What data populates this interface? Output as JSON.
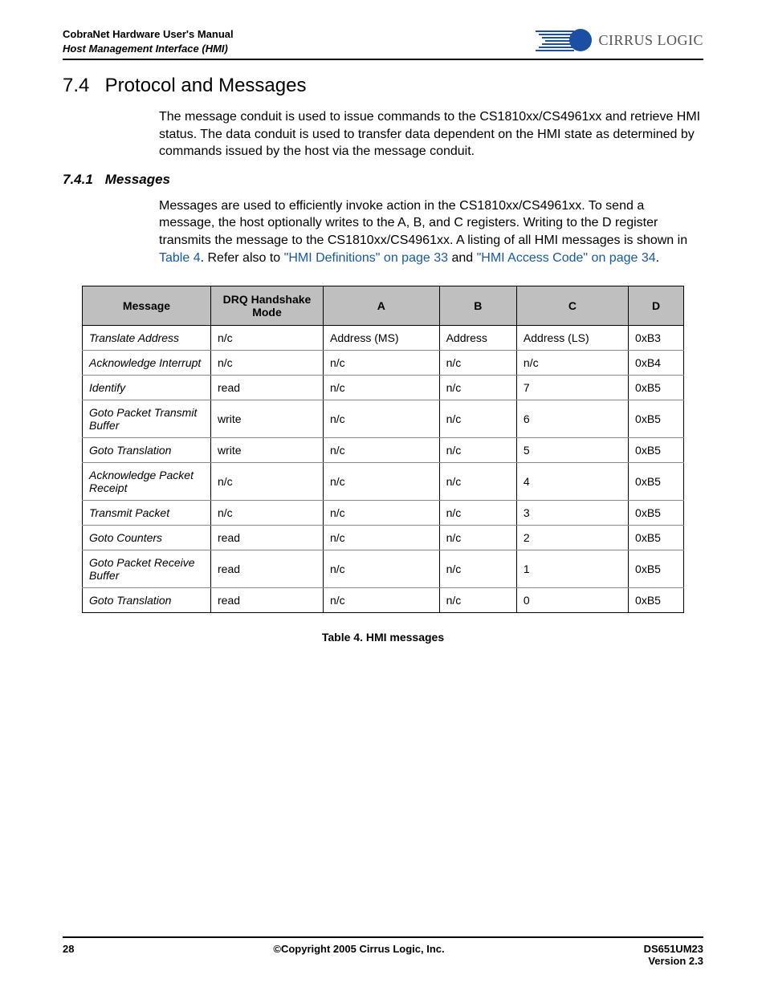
{
  "header": {
    "title_line1": "CobraNet Hardware User's Manual",
    "title_line2": "Host Management Interface (HMI)",
    "logo_text": "CIRRUS LOGIC"
  },
  "section": {
    "number": "7.4",
    "title": "Protocol and Messages",
    "intro": "The message conduit is used to issue commands to the CS1810xx/CS4961xx and retrieve HMI status. The data conduit is used to transfer data dependent on the HMI state as determined by commands issued by the host via the message conduit."
  },
  "subsection": {
    "number": "7.4.1",
    "title": "Messages",
    "para_pre": "Messages are used to efficiently invoke action in the CS1810xx/CS4961xx. To send a message, the host optionally writes to the A, B, and C registers. Writing to the D register transmits the message to the CS1810xx/CS4961xx. A listing of all HMI messages is shown in ",
    "link1": "Table 4",
    "para_mid1": ". Refer also to ",
    "link2": "\"HMI Definitions\" on page 33",
    "para_mid2": " and ",
    "link3": "\"HMI Access Code\" on page 34",
    "para_post": "."
  },
  "table": {
    "caption": "Table 4. HMI messages",
    "headers": [
      "Message",
      "DRQ Handshake Mode",
      "A",
      "B",
      "C",
      "D"
    ],
    "rows": [
      [
        "Translate Address",
        "n/c",
        "Address (MS)",
        "Address",
        "Address (LS)",
        "0xB3"
      ],
      [
        "Acknowledge Interrupt",
        "n/c",
        "n/c",
        "n/c",
        "n/c",
        "0xB4"
      ],
      [
        "Identify",
        "read",
        "n/c",
        "n/c",
        "7",
        "0xB5"
      ],
      [
        "Goto Packet Transmit Buffer",
        "write",
        "n/c",
        "n/c",
        "6",
        "0xB5"
      ],
      [
        "Goto Translation",
        "write",
        "n/c",
        "n/c",
        "5",
        "0xB5"
      ],
      [
        "Acknowledge Packet Receipt",
        "n/c",
        "n/c",
        "n/c",
        "4",
        "0xB5"
      ],
      [
        "Transmit Packet",
        "n/c",
        "n/c",
        "n/c",
        "3",
        "0xB5"
      ],
      [
        "Goto Counters",
        "read",
        "n/c",
        "n/c",
        "2",
        "0xB5"
      ],
      [
        "Goto Packet Receive Buffer",
        "read",
        "n/c",
        "n/c",
        "1",
        "0xB5"
      ],
      [
        "Goto Translation",
        "read",
        "n/c",
        "n/c",
        "0",
        "0xB5"
      ]
    ]
  },
  "footer": {
    "page": "28",
    "copyright": "©Copyright 2005 Cirrus Logic, Inc.",
    "docnum": "DS651UM23",
    "version": "Version 2.3"
  }
}
